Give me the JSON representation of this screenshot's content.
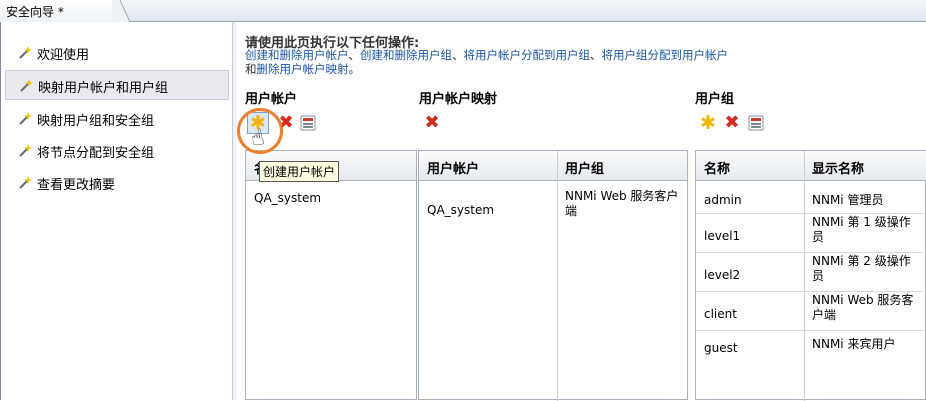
{
  "tab": {
    "title": "安全向导 *"
  },
  "sidebar": {
    "items": [
      {
        "label": "欢迎使用"
      },
      {
        "label": "映射用户帐户和用户组"
      },
      {
        "label": "映射用户组和安全组"
      },
      {
        "label": "将节点分配到安全组"
      },
      {
        "label": "查看更改摘要"
      }
    ]
  },
  "instructions": {
    "heading": "请使用此页执行以下任何操作:",
    "link1": "创建和删除用户帐户",
    "sep1": "、",
    "link2": "创建和删除用户组",
    "sep2": "、",
    "link3": "将用户帐户分配到用户组",
    "sep3": "、",
    "link4": "将用户组分配到用户帐户",
    "and": "和",
    "link5": "删除用户帐户映射",
    "end": "。"
  },
  "sections": {
    "accounts": {
      "title": "用户帐户"
    },
    "mappings": {
      "title": "用户帐户映射"
    },
    "groups": {
      "title": "用户组"
    }
  },
  "tooltip": "创建用户帐户",
  "accounts_table": {
    "header": "名称",
    "rows": [
      "QA_system"
    ]
  },
  "mappings_table": {
    "headers": [
      "用户帐户",
      "用户组"
    ],
    "rows": [
      {
        "account": "QA_system",
        "group": "NNMi Web 服务客户端"
      }
    ]
  },
  "groups_table": {
    "headers": [
      "名称",
      "显示名称"
    ],
    "rows": [
      {
        "name": "admin",
        "display": "NNMi 管理员"
      },
      {
        "name": "level1",
        "display": "NNMi 第 1 级操作员"
      },
      {
        "name": "level2",
        "display": "NNMi 第 2 级操作员"
      },
      {
        "name": "client",
        "display": "NNMi Web 服务客户端"
      },
      {
        "name": "guest",
        "display": "NNMi 来宾用户"
      }
    ]
  },
  "icons": {
    "new": "star-icon",
    "delete": "x-icon",
    "properties": "edit-form-icon",
    "nav": "wizard-step-icon"
  },
  "colors": {
    "accent_link": "#1a55a6",
    "highlight_ring": "#f07e2a",
    "tooltip_bg": "#ffffe1"
  }
}
